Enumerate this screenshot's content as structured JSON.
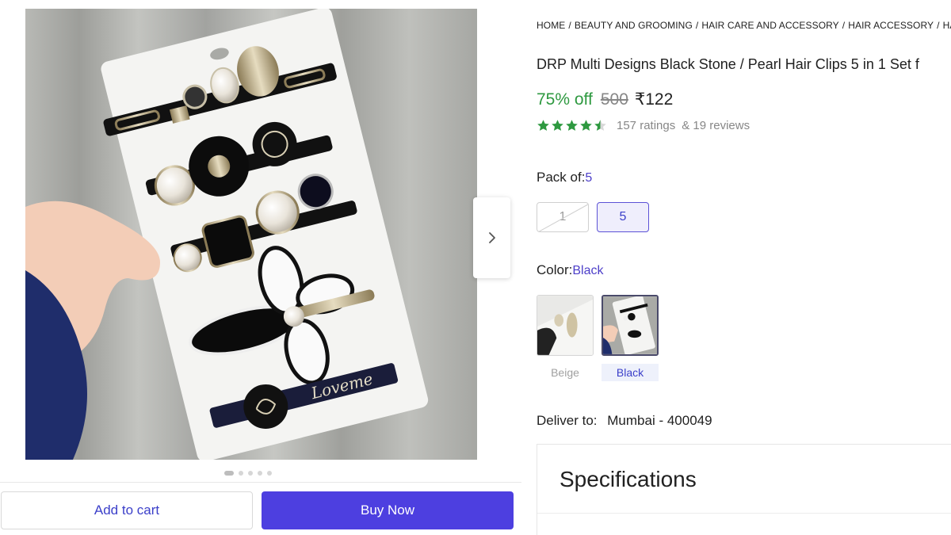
{
  "gallery": {
    "image_description_icon": "product-photo-hair-clips",
    "dots": [
      true,
      false,
      false,
      false,
      false
    ],
    "next_icon": "chevron-right-icon"
  },
  "actions": {
    "add_to_cart": "Add to cart",
    "buy_now": "Buy Now"
  },
  "breadcrumb": [
    "HOME",
    "BEAUTY AND GROOMING",
    "HAIR CARE AND ACCESSORY",
    "HAIR ACCESSORY",
    "HAIR C"
  ],
  "product": {
    "title": "DRP Multi Designs Black Stone / Pearl Hair Clips 5 in 1 Set f",
    "discount": "75% off",
    "mrp": "500",
    "price": "₹122",
    "rating_value": 4.5,
    "ratings": "157 ratings",
    "reviews": "& 19 reviews"
  },
  "pack": {
    "label": "Pack of:",
    "selected": "5",
    "options": [
      {
        "label": "1",
        "state": "disabled"
      },
      {
        "label": "5",
        "state": "selected"
      }
    ]
  },
  "color": {
    "label": "Color:",
    "selected": "Black",
    "options": [
      {
        "label": "Beige",
        "state": "available"
      },
      {
        "label": "Black",
        "state": "selected"
      }
    ]
  },
  "delivery": {
    "label": "Deliver to:",
    "location": "Mumbai - 400049"
  },
  "specifications": {
    "title": "Specifications"
  },
  "colors": {
    "accent": "#4d3fe0",
    "discount_green": "#2e9940",
    "star_green": "#2e9940"
  }
}
